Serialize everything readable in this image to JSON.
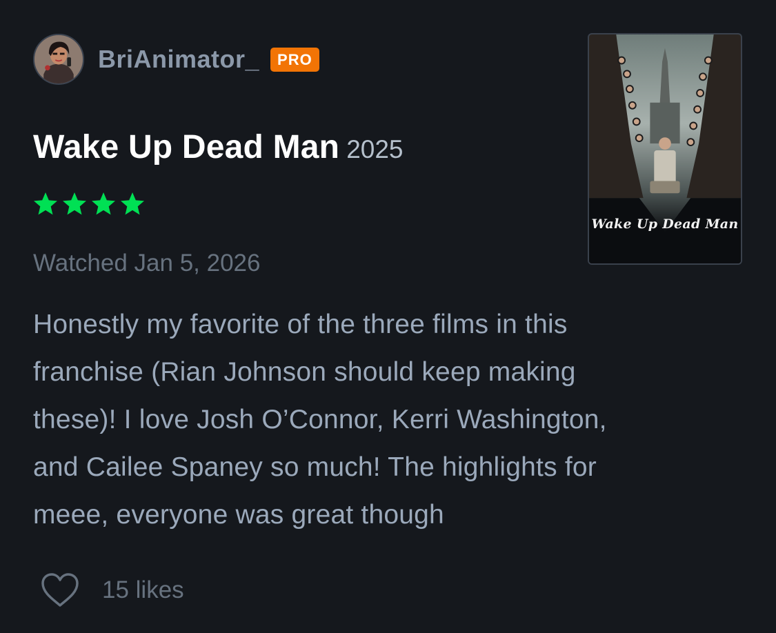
{
  "user": {
    "username": "BriAnimator_",
    "badge": "PRO"
  },
  "film": {
    "title": "Wake Up Dead Man",
    "year": "2025",
    "rating": 4,
    "poster_title": "Wake Up Dead Man"
  },
  "watched": "Watched Jan 5, 2026",
  "review": {
    "lines": [
      "Honestly my favorite of the three films in this",
      "franchise (Rian Johnson should keep making",
      "these)! I love Josh O’Connor, Kerri Washington,",
      "and Cailee Spaney so much! The highlights for",
      "meee, everyone was great though"
    ]
  },
  "likes": {
    "label": "15 likes"
  },
  "colors": {
    "background": "#15181d",
    "star": "#00e054",
    "pro_badge": "#f27405"
  },
  "icons": {
    "star": "star-icon",
    "heart": "heart-outline-icon"
  }
}
